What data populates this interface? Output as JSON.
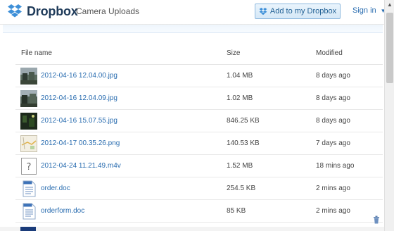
{
  "header": {
    "brand": "Dropbox",
    "folder_title": "Camera Uploads",
    "add_button_label": "Add to my Dropbox",
    "signin_label": "Sign in"
  },
  "table": {
    "columns": {
      "name": "File name",
      "size": "Size",
      "modified": "Modified"
    },
    "rows": [
      {
        "name": "2012-04-16 12.04.00.jpg",
        "size": "1.04 MB",
        "modified": "8 days ago",
        "icon": "photo-thumb-icon"
      },
      {
        "name": "2012-04-16 12.04.09.jpg",
        "size": "1.02 MB",
        "modified": "8 days ago",
        "icon": "photo-thumb-icon"
      },
      {
        "name": "2012-04-16 15.07.55.jpg",
        "size": "846.25 KB",
        "modified": "8 days ago",
        "icon": "photo-thumb-icon"
      },
      {
        "name": "2012-04-17 00.35.26.png",
        "size": "140.53 KB",
        "modified": "7 days ago",
        "icon": "map-thumb-icon"
      },
      {
        "name": "2012-04-24 11.21.49.m4v",
        "size": "1.52 MB",
        "modified": "18 mins ago",
        "icon": "unknown-file-icon"
      },
      {
        "name": "order.doc",
        "size": "254.5 KB",
        "modified": "2 mins ago",
        "icon": "doc-file-icon"
      },
      {
        "name": "orderform.doc",
        "size": "85 KB",
        "modified": "2 mins ago",
        "icon": "doc-file-icon"
      }
    ]
  },
  "colors": {
    "link": "#2a6db0",
    "brand_dark": "#1f3b5a",
    "brand_blue": "#3d8fd8"
  }
}
